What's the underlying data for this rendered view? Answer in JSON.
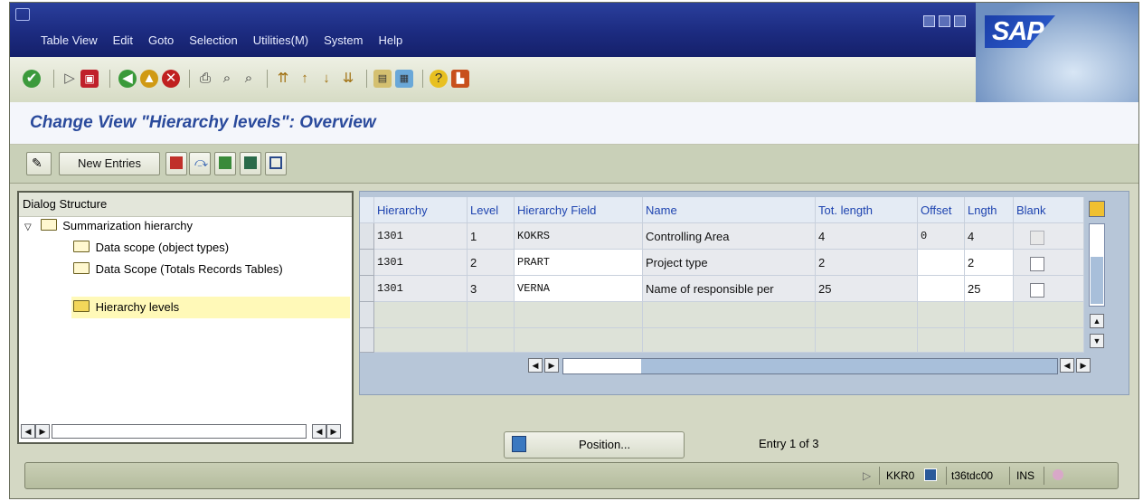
{
  "menu": [
    "Table View",
    "Edit",
    "Goto",
    "Selection",
    "Utilities(M)",
    "System",
    "Help"
  ],
  "brand": "SAP",
  "title": "Change View \"Hierarchy levels\": Overview",
  "app_toolbar": {
    "new_entries": "New Entries"
  },
  "dialog": {
    "header": "Dialog Structure",
    "tree": [
      {
        "label": "Summarization hierarchy",
        "level": 0,
        "expanded": true
      },
      {
        "label": "Data scope (object types)",
        "level": 1
      },
      {
        "label": "Data Scope (Totals Records Tables)",
        "level": 1
      },
      {
        "label": "Hierarchy levels",
        "level": 1,
        "selected": true
      }
    ]
  },
  "table": {
    "columns": [
      "Hierarchy",
      "Level",
      "Hierarchy Field",
      "Name",
      "Tot. length",
      "Offset",
      "Lngth",
      "Blank"
    ],
    "rows": [
      {
        "hierarchy": "1301",
        "level": "1",
        "field": "KOKRS",
        "name": "Controlling Area",
        "tot": "4",
        "offset": "0",
        "lngth": "4"
      },
      {
        "hierarchy": "1301",
        "level": "2",
        "field": "PRART",
        "name": "Project type",
        "tot": "2",
        "offset": "",
        "lngth": "2"
      },
      {
        "hierarchy": "1301",
        "level": "3",
        "field": "VERNA",
        "name": "Name of responsible per",
        "tot": "25",
        "offset": "",
        "lngth": "25"
      }
    ]
  },
  "position_button": "Position...",
  "entry_info": "Entry 1 of 3",
  "status": {
    "system": "KKR0",
    "transaction": "t36tdc00",
    "mode": "INS"
  },
  "colors": {
    "menu_bg": "#1c2b80",
    "title": "#2a4a9c",
    "header_text": "#1e44b0"
  }
}
